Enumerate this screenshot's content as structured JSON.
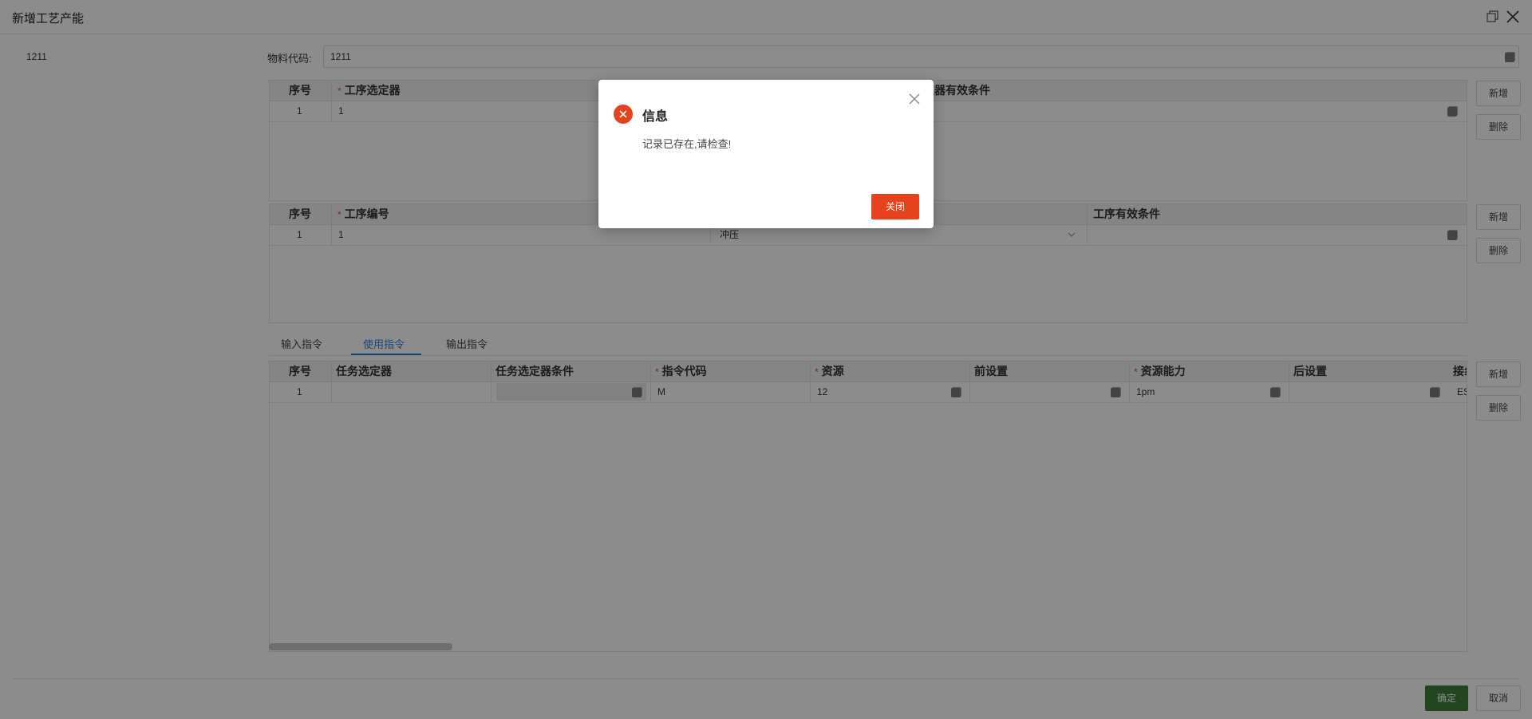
{
  "window": {
    "title": "新增工艺产能",
    "left_code": "1211"
  },
  "material": {
    "label": "物料代码:",
    "value": "1211"
  },
  "table1": {
    "headers": [
      "序号",
      "工序选定器",
      "选定器有效条件"
    ],
    "required": [
      false,
      true,
      false
    ],
    "rows": [
      [
        "1",
        "1",
        ""
      ]
    ]
  },
  "table2": {
    "headers": [
      "序号",
      "工序编号",
      "",
      "工序有效条件"
    ],
    "required": [
      false,
      true,
      false,
      false
    ],
    "rows": [
      [
        "1",
        "1",
        "冲压",
        ""
      ]
    ]
  },
  "side_buttons": {
    "add": "新增",
    "delete": "删除"
  },
  "tabs": [
    "输入指令",
    "使用指令",
    "输出指令"
  ],
  "active_tab": 1,
  "table3": {
    "headers": [
      "序号",
      "任务选定器",
      "任务选定器条件",
      "指令代码",
      "资源",
      "前设置",
      "资源能力",
      "后设置",
      "接纟"
    ],
    "required": [
      false,
      false,
      false,
      true,
      true,
      false,
      true,
      false,
      false
    ],
    "rows": [
      [
        "1",
        "",
        "",
        "M",
        "12",
        "",
        "1pm",
        "",
        "ES"
      ]
    ]
  },
  "footer": {
    "ok": "确定",
    "cancel": "取消"
  },
  "dialog": {
    "title": "信息",
    "message": "记录已存在,请检查!",
    "close_label": "关闭"
  },
  "colors": {
    "accent": "#2f7fd8",
    "error": "#e5421d",
    "confirm": "#3f7d3a"
  }
}
